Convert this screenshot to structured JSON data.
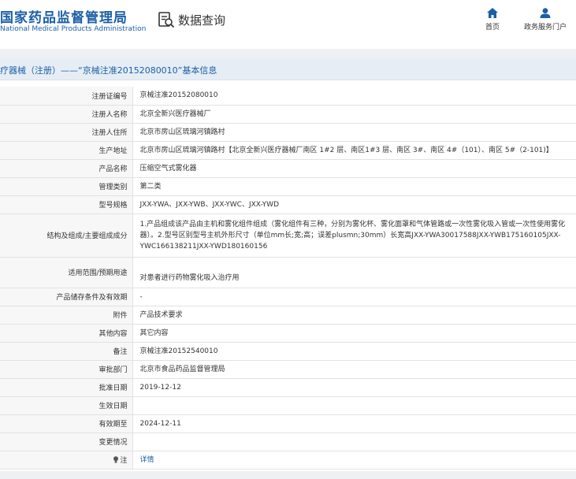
{
  "header": {
    "logo_cn": "国家药品监督管理局",
    "logo_en": "National Medical Products Administration",
    "query_label": "数据查询",
    "nav": {
      "home": "首页",
      "portal": "政务服务门户"
    }
  },
  "title": "疗器械（注册）——“京械注准20152080010”基本信息",
  "rows": [
    {
      "label": "注册证编号",
      "value": "京械注准20152080010"
    },
    {
      "label": "注册人名称",
      "value": "北京全新兴医疗器械厂"
    },
    {
      "label": "注册人住所",
      "value": "北京市房山区琉璃河镇路村"
    },
    {
      "label": "生产地址",
      "value": "北京市房山区琉璃河镇路村【北京全新兴医疗器械厂南区 1#2 层、南区1#3 层、南区 3#、南区 4#（101）、南区 5#（2-101)】"
    },
    {
      "label": "产品名称",
      "value": "压缩空气式雾化器"
    },
    {
      "label": "管理类别",
      "value": "第二类"
    },
    {
      "label": "型号规格",
      "value": "JXX-YWA、JXX-YWB、JXX-YWC、JXX-YWD"
    },
    {
      "label": "结构及组成/主要组成成分",
      "value": "1.产品组成该产品由主机和雾化组件组成（雾化组件有三种，分别为雾化杯、雾化面罩和气体管路或一次性雾化吸入管或一次性使用雾化器）。2.型号区别型号主机外形尺寸（单位mm长;宽;高；误差plusmn;30mm）长宽高JXX-YWA30017588JXX-YWB175160105JXX-YWC166138211JXX-YWD180160156"
    },
    {
      "label": "适用范围/预期用途",
      "value": "对患者进行药物雾化吸入治疗用"
    },
    {
      "label": "产品储存条件及有效期",
      "value": "-"
    },
    {
      "label": "附件",
      "value": "产品技术要求"
    },
    {
      "label": "其他内容",
      "value": "其它内容"
    },
    {
      "label": "备注",
      "value": "京械注准20152540010"
    },
    {
      "label": "审批部门",
      "value": "北京市食品药品监督管理局"
    },
    {
      "label": "批准日期",
      "value": "2019-12-12"
    },
    {
      "label": "生效日期",
      "value": ""
    },
    {
      "label": "有效期至",
      "value": "2024-12-11"
    },
    {
      "label": "变更情况",
      "value": ""
    }
  ],
  "note_row": {
    "label": "注",
    "link": "详情"
  }
}
